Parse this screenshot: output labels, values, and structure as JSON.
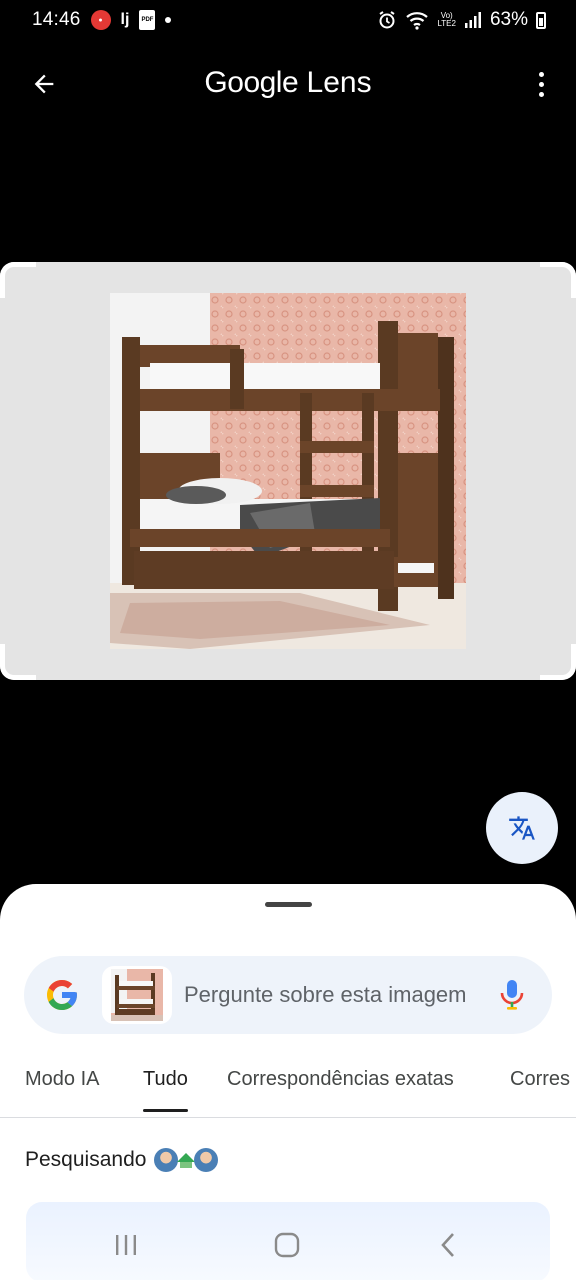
{
  "status_bar": {
    "time": "14:46",
    "notification_lj": "lj",
    "notification_pdf": "PDF",
    "volte_top": "Vo)",
    "volte_bottom": "LTE2",
    "battery_percent": "63%"
  },
  "app_bar": {
    "title_google": "Google",
    "title_lens": "Lens"
  },
  "search": {
    "placeholder": "Pergunte sobre esta imagem"
  },
  "tabs": [
    {
      "label": "Modo IA",
      "active": false
    },
    {
      "label": "Tudo",
      "active": true
    },
    {
      "label": "Correspondências exatas",
      "active": false
    },
    {
      "label": "Corres",
      "active": false
    }
  ],
  "results": {
    "status_label": "Pesquisando"
  },
  "colors": {
    "google_blue": "#4285F4",
    "google_red": "#EA4335",
    "google_yellow": "#FBBC05",
    "google_green": "#34A853",
    "fab_bg": "#eaf1fb",
    "search_bg": "#eef3fa"
  },
  "icons": {
    "back": "arrow-left-icon",
    "more": "more-vert-icon",
    "translate": "translate-icon",
    "mic": "mic-icon",
    "google": "google-g-icon"
  }
}
